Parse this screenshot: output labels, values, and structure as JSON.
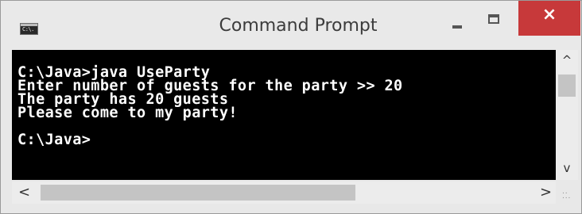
{
  "window": {
    "title": "Command Prompt",
    "icon_text": "C:\\.",
    "controls": {
      "minimize": "minimize-icon",
      "maximize": "maximize-icon",
      "close_symbol": "×"
    }
  },
  "console": {
    "lines": [
      "C:\\Java>java UseParty",
      "Enter number of guests for the party >> 20",
      "The party has 20 guests",
      "Please come to my party!",
      "",
      "C:\\Java>"
    ]
  },
  "scrollbars": {
    "up_arrow": "^",
    "down_arrow": "v",
    "left_arrow": "<",
    "right_arrow": ">"
  },
  "colors": {
    "console_background": "#000000",
    "console_text": "#ffffff",
    "close_button": "#c7393a"
  }
}
